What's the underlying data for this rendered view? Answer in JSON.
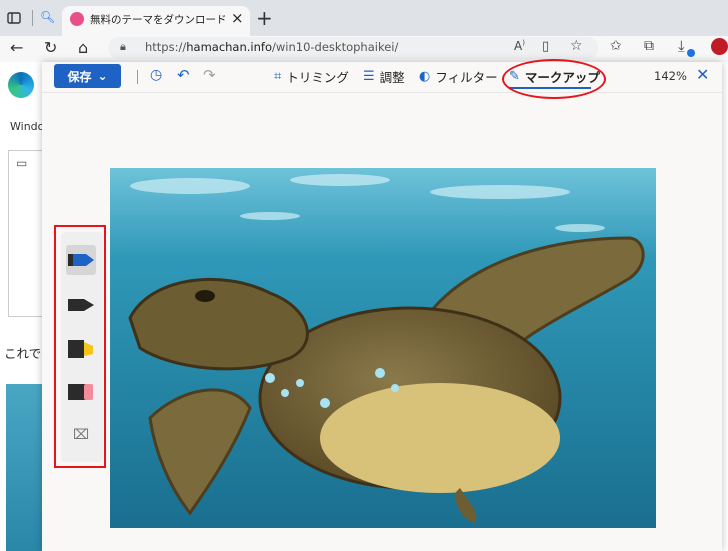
{
  "browser": {
    "tab_title": "無料のテーマをダウンロードして壁紙！",
    "url_scheme": "https://",
    "url_host": "hamachan.info",
    "url_path": "/win10-desktophaikei/"
  },
  "page": {
    "snippet_top": "Windo",
    "snippet_mid": "これで"
  },
  "editor": {
    "save_label": "保存",
    "crop_label": "トリミング",
    "adjust_label": "調整",
    "filter_label": "フィルター",
    "markup_label": "マークアップ",
    "zoom": "142%"
  },
  "palette": {
    "tools": [
      "pen-blue-icon",
      "pen-black-icon",
      "highlighter-yellow-icon",
      "eraser-icon",
      "clear-canvas-icon"
    ],
    "colors": {
      "blue": "#1e63c4",
      "black": "#2b2b2b",
      "yellow": "#f5c518",
      "eraser_pink": "#f28b9b"
    }
  },
  "colors": {
    "accent": "#1e63c4",
    "annotation_red": "#e8141c"
  }
}
